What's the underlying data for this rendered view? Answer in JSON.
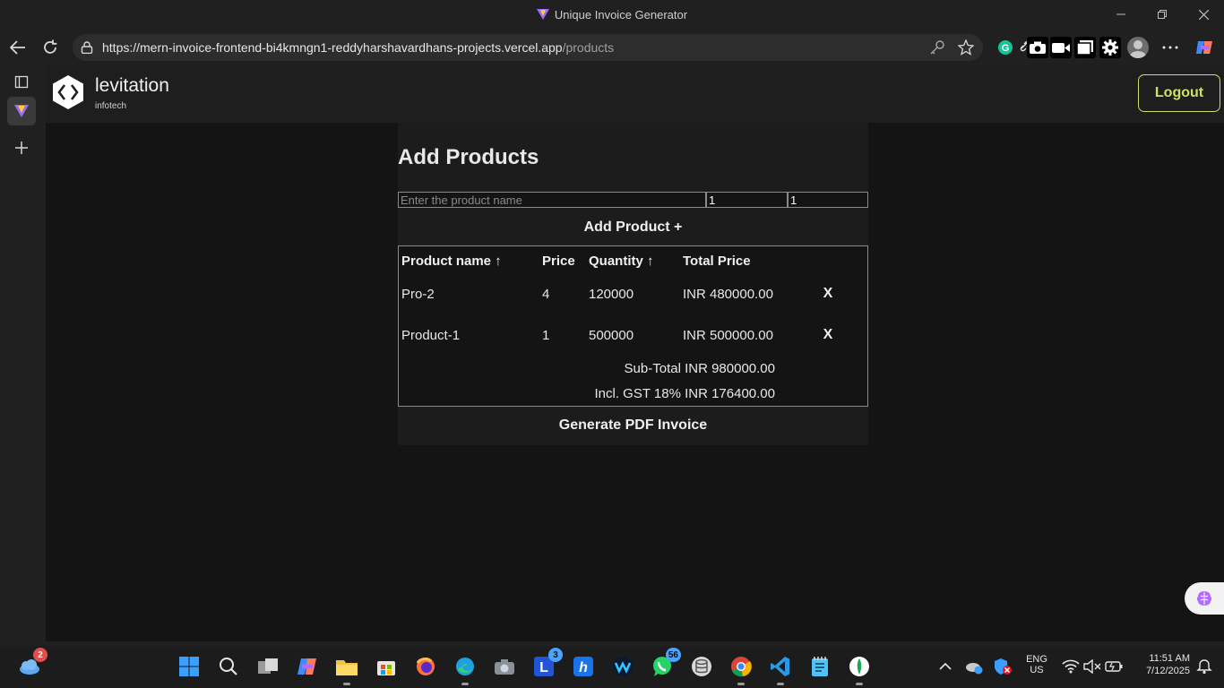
{
  "window": {
    "title": "Unique Invoice Generator",
    "controls": [
      "minimize",
      "restore",
      "close"
    ]
  },
  "browser": {
    "url_host": "https://mern-invoice-frontend-bi4kmngn1-reddyharshavardhans-projects.vercel.app",
    "url_path": "/products",
    "icons": [
      "back-icon",
      "refresh-icon",
      "lock-icon",
      "key-icon",
      "star-icon",
      "grammarly-icon",
      "camera-icon",
      "video-icon",
      "copy-icon",
      "gear-icon",
      "profile-avatar",
      "more-icon",
      "copilot-icon"
    ]
  },
  "app": {
    "brand_name": "levitation",
    "brand_sub": "infotech",
    "logout_label": "Logout",
    "heading": "Add Products",
    "form": {
      "name_placeholder": "Enter the product name",
      "price_value": "1",
      "quantity_value": "1",
      "add_label": "Add Product +"
    },
    "table": {
      "headers": [
        "Product name ↑",
        "Price",
        "Quantity ↑",
        "Total Price"
      ],
      "rows": [
        {
          "name": "Pro-2",
          "price": "4",
          "quantity": "120000",
          "total": "INR 480000.00",
          "remove": "X"
        },
        {
          "name": "Product-1",
          "price": "1",
          "quantity": "500000",
          "total": "INR 500000.00",
          "remove": "X"
        }
      ],
      "subtotal": "Sub-Total INR 980000.00",
      "gst": "Incl. GST 18% INR 176400.00"
    },
    "generate_label": "Generate PDF Invoice"
  },
  "taskbar": {
    "weather_badge": "2",
    "calendar_badge": "3",
    "whatsapp_badge": "56",
    "lang": "ENG",
    "region": "US",
    "time": "11:51 AM",
    "date": "7/12/2025"
  },
  "colors": {
    "accent_logout": "#c9e265",
    "page_bg": "#141414",
    "header_bg": "#1e1e1e"
  }
}
